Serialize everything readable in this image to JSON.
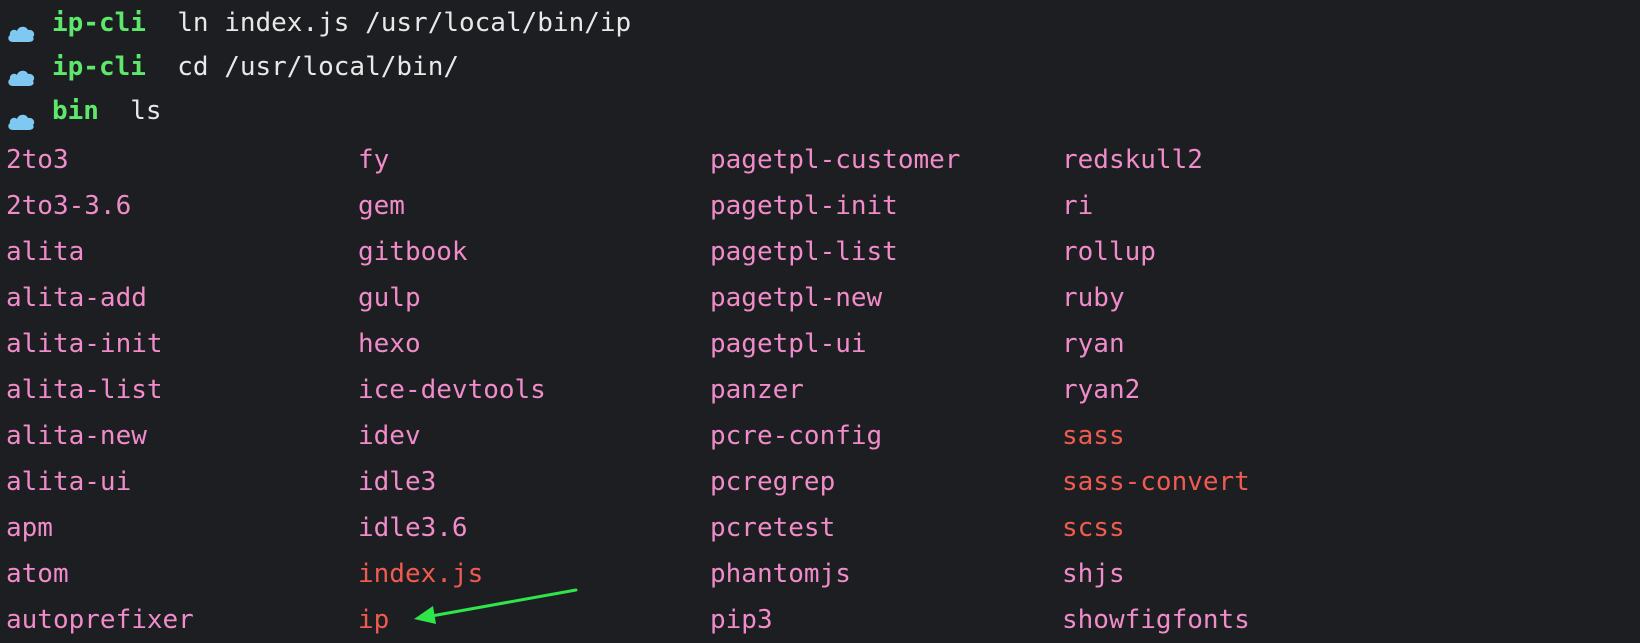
{
  "prompts": [
    {
      "cwd": "ip-cli",
      "command": "ln index.js /usr/local/bin/ip"
    },
    {
      "cwd": "ip-cli",
      "command": "cd /usr/local/bin/"
    },
    {
      "cwd": "bin",
      "command": "ls"
    }
  ],
  "prompt_icon": "cloud-icon",
  "colors": {
    "background": "#1d1e22",
    "cwd": "#5ee86b",
    "command": "#e8e8e8",
    "file": "#f08cc9",
    "highlighted_file": "#f05b4f",
    "arrow": "#2ee64a"
  },
  "listing": {
    "columns": [
      [
        {
          "name": "2to3"
        },
        {
          "name": "2to3-3.6"
        },
        {
          "name": "alita"
        },
        {
          "name": "alita-add"
        },
        {
          "name": "alita-init"
        },
        {
          "name": "alita-list"
        },
        {
          "name": "alita-new"
        },
        {
          "name": "alita-ui"
        },
        {
          "name": "apm"
        },
        {
          "name": "atom"
        },
        {
          "name": "autoprefixer"
        }
      ],
      [
        {
          "name": "fy"
        },
        {
          "name": "gem"
        },
        {
          "name": "gitbook"
        },
        {
          "name": "gulp"
        },
        {
          "name": "hexo"
        },
        {
          "name": "ice-devtools"
        },
        {
          "name": "idev"
        },
        {
          "name": "idle3"
        },
        {
          "name": "idle3.6"
        },
        {
          "name": "index.js",
          "red": true
        },
        {
          "name": "ip",
          "red": true
        }
      ],
      [
        {
          "name": "pagetpl-customer"
        },
        {
          "name": "pagetpl-init"
        },
        {
          "name": "pagetpl-list"
        },
        {
          "name": "pagetpl-new"
        },
        {
          "name": "pagetpl-ui"
        },
        {
          "name": "panzer"
        },
        {
          "name": "pcre-config"
        },
        {
          "name": "pcregrep"
        },
        {
          "name": "pcretest"
        },
        {
          "name": "phantomjs"
        },
        {
          "name": "pip3"
        }
      ],
      [
        {
          "name": "redskull2"
        },
        {
          "name": "ri"
        },
        {
          "name": "rollup"
        },
        {
          "name": "ruby"
        },
        {
          "name": "ryan"
        },
        {
          "name": "ryan2"
        },
        {
          "name": "sass",
          "red": true
        },
        {
          "name": "sass-convert",
          "red": true
        },
        {
          "name": "scss",
          "red": true
        },
        {
          "name": "shjs"
        },
        {
          "name": "showfigfonts"
        }
      ]
    ]
  },
  "annotation": {
    "type": "arrow",
    "points_to": "ip"
  }
}
